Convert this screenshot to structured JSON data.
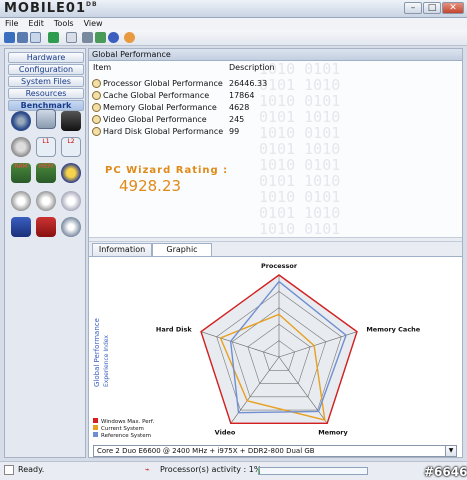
{
  "window": {
    "logo": "MOBILE01",
    "logo_sup": "DB",
    "minimize": "–",
    "maximize": "□",
    "close": "✕"
  },
  "menu": [
    "File",
    "Edit",
    "Tools",
    "View"
  ],
  "sidebar": {
    "nav": [
      "Hardware",
      "Configuration",
      "System Files",
      "Resources",
      "Benchmark"
    ],
    "active_index": 4,
    "tile_icons": [
      "cpu-disc-icon",
      "memory-chip-icon",
      "hard-disk-icon",
      "ram-icon",
      "mem-icon",
      "gpu-icon",
      "network-icon",
      "cache-icon",
      "disc-icon",
      "video-icon",
      "audio-icon",
      "settings-icon"
    ],
    "tile_labels": {
      "l1": "L1",
      "l2": "L2",
      "ram": "RAM",
      "mem": "MEM"
    }
  },
  "panel": {
    "title": "Global Performance",
    "col_item": "Item",
    "col_desc": "Description",
    "rows": [
      {
        "item": "Processor Global Performance",
        "value": "26446.33"
      },
      {
        "item": "Cache Global Performance",
        "value": "17864"
      },
      {
        "item": "Memory Global Performance",
        "value": "4628"
      },
      {
        "item": "Video Global Performance",
        "value": "245"
      },
      {
        "item": "Hard Disk Global Performance",
        "value": "99"
      }
    ],
    "rating_label": "PC Wizard Rating :",
    "rating_value": "4928.23",
    "binary_bg": "1010 0101\n0101 1010\n1010 0101\n0101 1010\n1010 0101\n0101 1010\n1010 0101\n0101 1010\n1010 0101\n0101 1010\n1010 0101"
  },
  "tabs": [
    "Information",
    "Graphic"
  ],
  "selected_tab": 1,
  "chart_data": {
    "type": "radar",
    "axes": [
      "Processor",
      "Memory Cache",
      "Memory",
      "Video",
      "Hard Disk"
    ],
    "rmax": 1.0,
    "rings": 5,
    "y_title": "Global Performance",
    "y_subtitle": "Experience Index",
    "series": [
      {
        "name": "Windows Max. Perf.",
        "color": "#d42020",
        "values": [
          1.0,
          1.0,
          1.0,
          1.0,
          1.0
        ]
      },
      {
        "name": "Current System",
        "color": "#e8a020",
        "values": [
          0.52,
          0.45,
          0.95,
          0.66,
          0.75
        ]
      },
      {
        "name": "Reference System",
        "color": "#6f8fd0",
        "values": [
          0.92,
          0.86,
          0.82,
          0.84,
          0.62
        ]
      }
    ]
  },
  "combo_value": "Core 2 Duo E6600 @ 2400 MHz + i975X + DDR2-800 Dual GB",
  "status": {
    "ready": "Ready.",
    "activity": "Processor(s) activity : 1%",
    "activity_pct": 0.01
  },
  "watermark": "#6646",
  "colors": {
    "accent": "#e08a18",
    "nav_text": "#1c3d8c"
  }
}
